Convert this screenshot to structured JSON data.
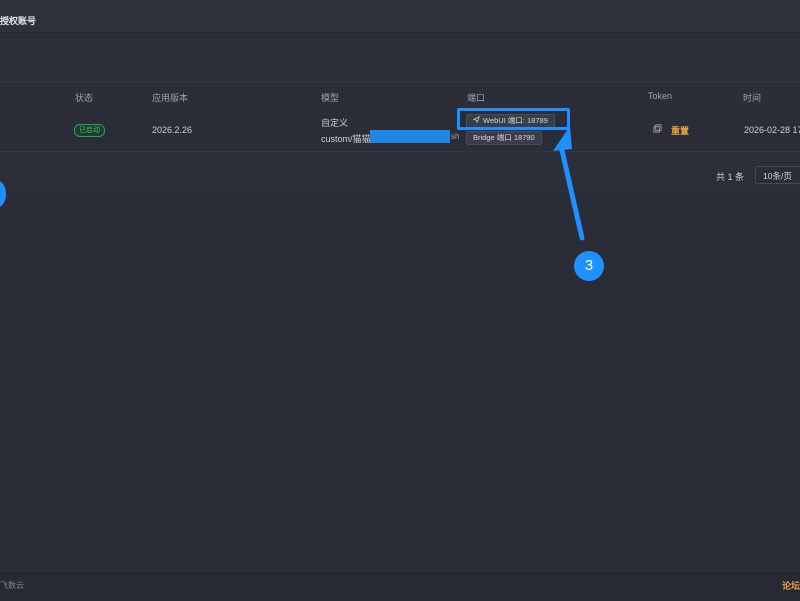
{
  "header": {
    "title": "授权账号"
  },
  "table": {
    "columns": [
      "状态",
      "应用版本",
      "模型",
      "端口",
      "Token",
      "时间"
    ],
    "row": {
      "status": "已启动",
      "version": "2026.2.26",
      "model_line1": "自定义",
      "model_line2_prefix": "custom/猫猫",
      "model_line2_suffix": "sh",
      "webui_port": "WebUI 端口: 18789",
      "bridge_port": "Bridge 端口 18790",
      "token_action": "重置",
      "time": "2026-02-28 17"
    }
  },
  "pagination": {
    "total": "共 1 条",
    "page_size": "10条/页"
  },
  "annotation": {
    "step_number": "3"
  },
  "footer": {
    "left_text": "飞数云",
    "right_link": "论坛"
  },
  "colors": {
    "accent": "#1e90ff",
    "success": "#41c173",
    "warning": "#e3a241"
  }
}
